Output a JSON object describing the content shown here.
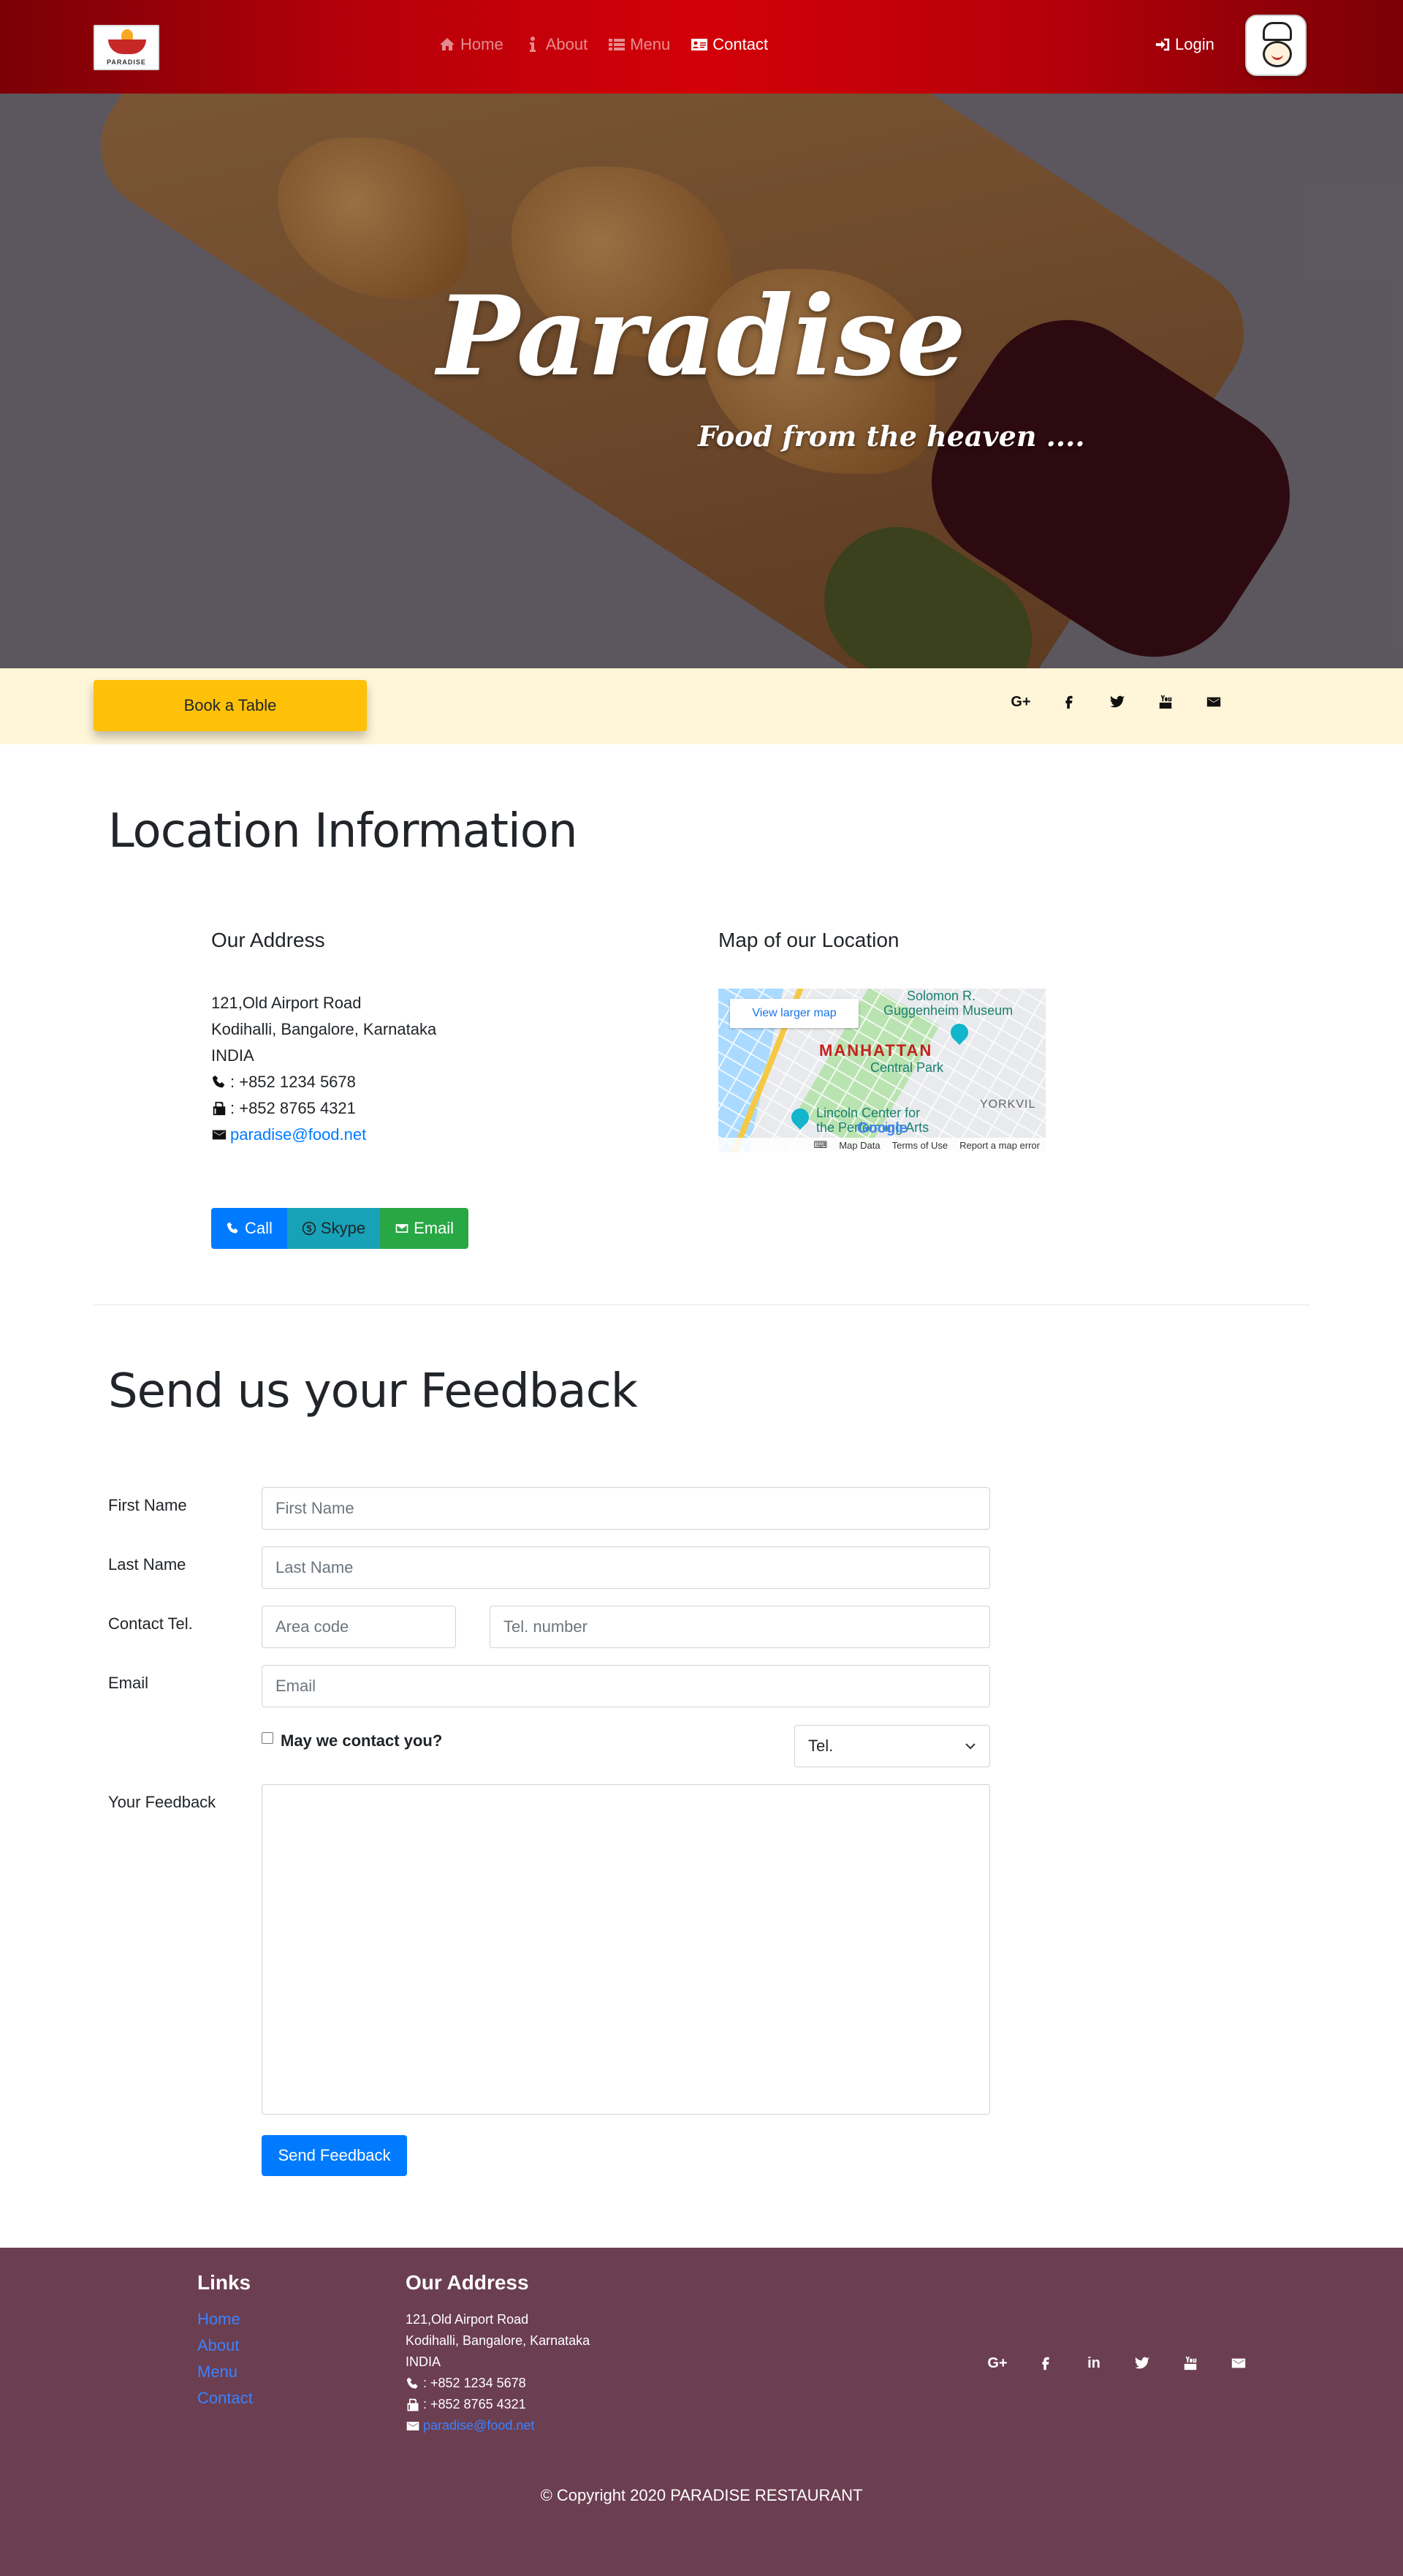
{
  "nav": {
    "logo_text": "PARADISE",
    "items": [
      {
        "label": "Home",
        "icon": "home-icon",
        "active": false
      },
      {
        "label": "About",
        "icon": "info-icon",
        "active": false
      },
      {
        "label": "Menu",
        "icon": "list-icon",
        "active": false
      },
      {
        "label": "Contact",
        "icon": "address-card-icon",
        "active": true
      }
    ],
    "login_label": "Login"
  },
  "hero": {
    "title": "Paradise",
    "subtitle": "Food from the heaven ...."
  },
  "bookbar": {
    "book_label": "Book a Table",
    "social": [
      "google-plus-icon",
      "facebook-icon",
      "twitter-icon",
      "youtube-icon",
      "envelope-icon"
    ]
  },
  "location": {
    "title": "Location Information",
    "address_heading": "Our Address",
    "address_lines": [
      "121,Old Airport Road",
      "Kodihalli, Bangalore, Karnataka",
      "INDIA"
    ],
    "phone": ": +852 1234 5678",
    "fax": ": +852 8765 4321",
    "email": "paradise@food.net",
    "map_heading": "Map of our Location",
    "map": {
      "larger_map": "View larger map",
      "labels": [
        "Solomon R.",
        "Guggenheim Museum",
        "MANHATTAN",
        "Central Park",
        "YORKVIL",
        "Lincoln Center for",
        "the Performing Arts"
      ],
      "google": "Google",
      "footer": [
        "Map Data",
        "Terms of Use",
        "Report a map error"
      ]
    },
    "buttons": {
      "call": "Call",
      "skype": "Skype",
      "email": "Email"
    }
  },
  "feedback": {
    "title": "Send us your Feedback",
    "first_name_label": "First Name",
    "first_name_placeholder": "First Name",
    "last_name_label": "Last Name",
    "last_name_placeholder": "Last Name",
    "tel_label": "Contact Tel.",
    "area_placeholder": "Area code",
    "tel_placeholder": "Tel. number",
    "email_label": "Email",
    "email_placeholder": "Email",
    "contact_check_label": "May we contact you?",
    "contact_method": "Tel.",
    "feedback_label": "Your Feedback",
    "send_label": "Send Feedback"
  },
  "footer": {
    "links_heading": "Links",
    "links": [
      "Home",
      "About",
      "Menu",
      "Contact"
    ],
    "address_heading": "Our Address",
    "address_lines": [
      "121,Old Airport Road",
      "Kodihalli, Bangalore, Karnataka",
      "INDIA"
    ],
    "phone": ": +852 1234 5678",
    "fax": ": +852 8765 4321",
    "email": "paradise@food.net",
    "social": [
      "google-plus-icon",
      "facebook-icon",
      "linkedin-icon",
      "twitter-icon",
      "youtube-icon",
      "envelope-icon"
    ],
    "copyright": "© Copyright 2020 PARADISE RESTAURANT"
  }
}
